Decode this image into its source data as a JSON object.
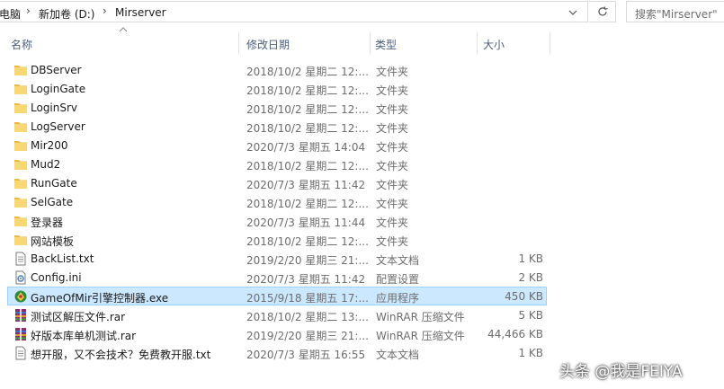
{
  "address": {
    "crumbs": [
      "电脑",
      "新加卷 (D:)",
      "Mirserver"
    ],
    "search_placeholder": "搜索\"Mirserver\""
  },
  "columns": {
    "name": "名称",
    "date": "修改日期",
    "type": "类型",
    "size": "大小"
  },
  "files": [
    {
      "name": "DBServer",
      "date": "2018/10/2 星期二 12:...",
      "type": "文件夹",
      "size": "",
      "icon": "folder-icon"
    },
    {
      "name": "LoginGate",
      "date": "2018/10/2 星期二 12:...",
      "type": "文件夹",
      "size": "",
      "icon": "folder-icon"
    },
    {
      "name": "LoginSrv",
      "date": "2018/10/2 星期二 12:...",
      "type": "文件夹",
      "size": "",
      "icon": "folder-icon"
    },
    {
      "name": "LogServer",
      "date": "2018/10/2 星期二 12:...",
      "type": "文件夹",
      "size": "",
      "icon": "folder-icon"
    },
    {
      "name": "Mir200",
      "date": "2020/7/3 星期五 14:04",
      "type": "文件夹",
      "size": "",
      "icon": "folder-icon"
    },
    {
      "name": "Mud2",
      "date": "2018/10/2 星期二 12:...",
      "type": "文件夹",
      "size": "",
      "icon": "folder-icon"
    },
    {
      "name": "RunGate",
      "date": "2020/7/3 星期五 11:42",
      "type": "文件夹",
      "size": "",
      "icon": "folder-icon"
    },
    {
      "name": "SelGate",
      "date": "2018/10/2 星期二 12:...",
      "type": "文件夹",
      "size": "",
      "icon": "folder-icon"
    },
    {
      "name": "登录器",
      "date": "2020/7/3 星期五 11:44",
      "type": "文件夹",
      "size": "",
      "icon": "folder-icon"
    },
    {
      "name": "网站模板",
      "date": "2018/10/2 星期二 12:...",
      "type": "文件夹",
      "size": "",
      "icon": "folder-icon"
    },
    {
      "name": "BackList.txt",
      "date": "2019/2/20 星期三 21:...",
      "type": "文本文档",
      "size": "1 KB",
      "icon": "text-file-icon"
    },
    {
      "name": "Config.ini",
      "date": "2020/7/3 星期五 11:42",
      "type": "配置设置",
      "size": "2 KB",
      "icon": "ini-file-icon"
    },
    {
      "name": "GameOfMir引擎控制器.exe",
      "date": "2015/9/18 星期五 17:...",
      "type": "应用程序",
      "size": "450 KB",
      "icon": "exe-icon",
      "selected": true
    },
    {
      "name": "测试区解压文件.rar",
      "date": "2018/10/2 星期二 13:...",
      "type": "WinRAR 压缩文件",
      "size": "5 KB",
      "icon": "rar-icon"
    },
    {
      "name": "好版本库单机测试.rar",
      "date": "2019/2/20 星期三 21:...",
      "type": "WinRAR 压缩文件",
      "size": "44,466 KB",
      "icon": "rar-icon"
    },
    {
      "name": "想开服，又不会技术？免费教开服.txt",
      "date": "2020/7/3 星期五 16:55",
      "type": "文本文档",
      "size": "1 KB",
      "icon": "text-file-icon"
    }
  ],
  "watermark": "头条 @我是FEIYA",
  "colors": {
    "folder": "#f8d775",
    "selection": "#cce8ff",
    "selection_border": "#99d1ff",
    "header_text": "#4c607a"
  }
}
